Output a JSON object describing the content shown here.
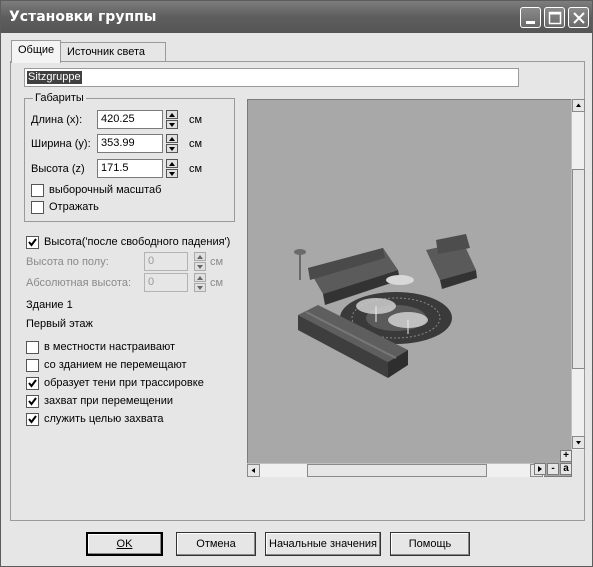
{
  "window": {
    "title": "Установки группы"
  },
  "titlebar_buttons": {
    "minimize_icon": "minimize-icon",
    "maximize_icon": "maximize-icon",
    "close_icon": "close-icon"
  },
  "tabs": [
    {
      "label": "Общие",
      "active": true
    },
    {
      "label": "Источник света",
      "active": false
    }
  ],
  "name_field": {
    "value": "Sitzgruppe"
  },
  "dimensions": {
    "legend": "Габариты",
    "length_label": "Длина (x):",
    "length_value": "420.25",
    "length_unit": "см",
    "width_label": "Ширина (y):",
    "width_value": "353.99",
    "width_unit": "см",
    "height_label": "Высота (z)",
    "height_value": "171.5",
    "height_unit": "см",
    "selective_scale_label": "выборочный масштаб",
    "selective_scale_checked": false,
    "mirror_label": "Отражать",
    "mirror_checked": false
  },
  "elevation": {
    "checkbox_label": "Высота('после свободного падения')",
    "checked": true,
    "floor_height_label": "Высота по полу:",
    "floor_height_value": "0",
    "floor_height_unit": "см",
    "absolute_height_label": "Абсолютная  высота:",
    "absolute_height_value": "0",
    "absolute_height_unit": "см"
  },
  "location": {
    "building": "Здание 1",
    "floor": "Первый этаж"
  },
  "options": [
    {
      "label": "в местности настраивают",
      "checked": false
    },
    {
      "label": "со зданием не перемещают",
      "checked": false
    },
    {
      "label": "образует тени при трассировке",
      "checked": true
    },
    {
      "label": "захват при перемещении",
      "checked": true
    },
    {
      "label": "служить целью захвата",
      "checked": true
    }
  ],
  "preview_controls": {
    "plus": "+",
    "minus": "-",
    "a": "a"
  },
  "buttons": {
    "ok": "OK",
    "cancel": "Отмена",
    "defaults": "Начальные значения",
    "help": "Помощь"
  },
  "colors": {
    "titlebar": "#5e5e5e",
    "preview_bg": "#a8a8a8",
    "dialog_bg": "#e6e6e6"
  }
}
